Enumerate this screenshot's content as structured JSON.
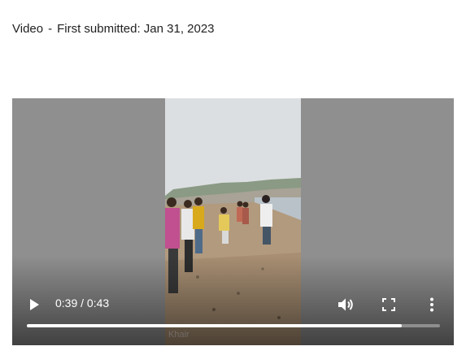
{
  "header": {
    "media_type": "Video",
    "separator": "-",
    "submitted_text": "First submitted: Jan 31, 2023"
  },
  "player": {
    "time_display": "0:39 / 0:43",
    "progress_fraction": 0.907,
    "watermark": "Khair",
    "controls": {
      "play_icon": "play-icon",
      "volume_icon": "volume-icon",
      "fullscreen_icon": "fullscreen-icon",
      "more_icon": "more-options-icon"
    }
  },
  "colors": {
    "letterbox": "#8f8f8f",
    "controls": "#ffffff"
  }
}
